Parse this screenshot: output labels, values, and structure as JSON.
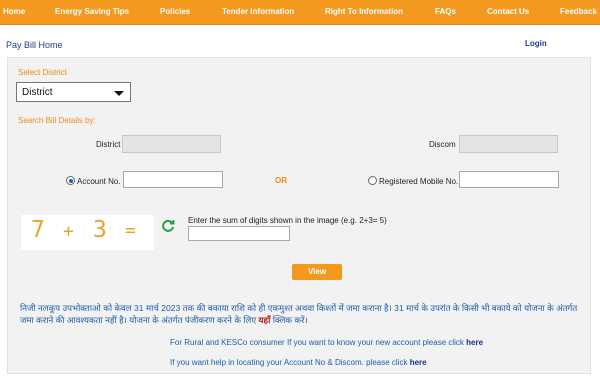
{
  "nav": {
    "items": [
      "Home",
      "Energy Saving Tips",
      "Policies",
      "Tender Information",
      "Right To Information",
      "FAQs",
      "Contact Us",
      "Feedback"
    ]
  },
  "header": {
    "page_title": "Pay Bill Home",
    "login_label": "Login"
  },
  "form": {
    "select_district_label": "Select District",
    "district_select_value": "District",
    "search_bill_label": "Search Bill Details by:",
    "district_label": "District",
    "discom_label": "Discom",
    "account_no_label": "Account No.",
    "or_label": "OR",
    "registered_mobile_label": "Registered Mobile No.",
    "selected_search_option": "Account No.",
    "captcha": {
      "digit1": "7",
      "operator": "+",
      "digit2": "3",
      "equals": "=",
      "instruction": "Enter the sum of digits shown in the image (e.g. 2+3= 5)"
    },
    "view_button_label": "View"
  },
  "notice": {
    "hindi_text_part1": "निजी नलकूप उपभोक्ताओ को केवल 31 मार्च 2023 तक की बकाया राशि को ही एकमुश्त अथवा किश्तों में जमा कराना है। 31 मार्च के उपरांत के किसी भी बकाये को योजना के अंतर्गत जमा कराने की आवश्यकता नहीं है। योजना के अंतर्गत पंजीकरण करने के लिए",
    "hindi_link": "यहाँ",
    "hindi_text_part2": "क्लिक करें।"
  },
  "links": {
    "rural_text": "For Rural and KESCo consumer If you want to know your new account please click",
    "rural_link": "here",
    "locate_text": "If you want help in locating your Account No & Discom. please click",
    "locate_link": "here"
  },
  "colors": {
    "nav_bg": "#f39a1e",
    "accent_orange": "#f08a1a",
    "link_blue": "#1e5ea8"
  }
}
